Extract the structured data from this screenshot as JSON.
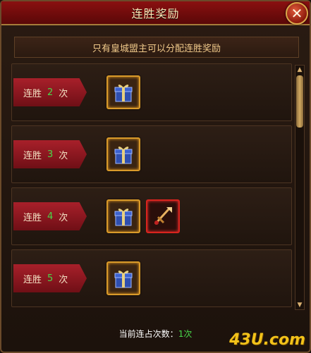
{
  "window": {
    "title": "连胜奖励",
    "close_glyph": "✕"
  },
  "notice": "只有皇城盟主可以分配连胜奖励",
  "rows": [
    {
      "prefix": "连胜",
      "count": "2",
      "suffix": "次",
      "rewards": [
        "gift-box-icon"
      ]
    },
    {
      "prefix": "连胜",
      "count": "3",
      "suffix": "次",
      "rewards": [
        "gift-box-icon"
      ]
    },
    {
      "prefix": "连胜",
      "count": "4",
      "suffix": "次",
      "rewards": [
        "gift-box-icon",
        "weapon-icon"
      ]
    },
    {
      "prefix": "连胜",
      "count": "5",
      "suffix": "次",
      "rewards": [
        "gift-box-icon"
      ]
    }
  ],
  "footer": {
    "label": "当前连占次数：",
    "value": "1次"
  },
  "watermark": "43U.com",
  "colors": {
    "accent_green": "#48d84a",
    "title_red": "#8a1010",
    "slot_gold": "#d99a2a",
    "slot_red": "#d8241e"
  }
}
